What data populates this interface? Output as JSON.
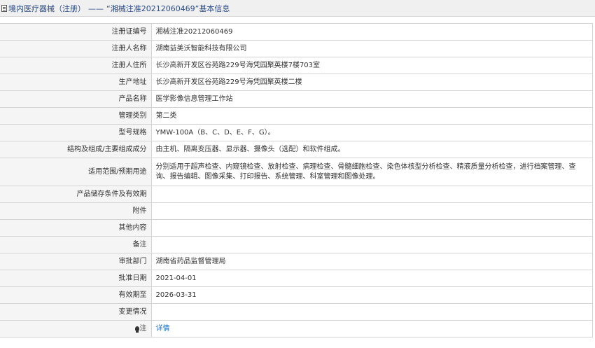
{
  "header": {
    "prefix": "境内医疗器械（注册）",
    "separator": "——",
    "subtitle": "“湘械注准20212060469”基本信息",
    "icon": "document-icon"
  },
  "rows": [
    {
      "label": "注册证编号",
      "value": "湘械注准20212060469"
    },
    {
      "label": "注册人名称",
      "value": "湖南益美沃智能科技有限公司"
    },
    {
      "label": "注册人住所",
      "value": "长沙高新开发区谷苑路229号海凭园聚英楼7楼703室"
    },
    {
      "label": "生产地址",
      "value": "长沙高新开发区谷苑路229号海凭园聚英楼二楼"
    },
    {
      "label": "产品名称",
      "value": "医学影像信息管理工作站"
    },
    {
      "label": "管理类别",
      "value": "第二类"
    },
    {
      "label": "型号规格",
      "value": "YMW-100A（B、C、D、E、F、G）。"
    },
    {
      "label": "结构及组成/主要组成成分",
      "value": "由主机、隔离变压器、显示器、摄像头（选配）和软件组成。"
    },
    {
      "label": "适用范围/预期用途",
      "value": "分别适用于超声检查、内窥镜检查、放射检查、病理检查、骨髓细胞检查、染色体核型分析检查、精液质量分析检查，进行档案管理、查询、报告编辑、图像采集、打印报告、系统管理、科室管理和图像处理。"
    },
    {
      "label": "产品储存条件及有效期",
      "value": ""
    },
    {
      "label": "附件",
      "value": ""
    },
    {
      "label": "其他内容",
      "value": ""
    },
    {
      "label": "备注",
      "value": ""
    },
    {
      "label": "审批部门",
      "value": "湖南省药品监督管理局"
    },
    {
      "label": "批准日期",
      "value": "2021-04-01"
    },
    {
      "label": "有效期至",
      "value": "2026-03-31"
    },
    {
      "label": "变更情况",
      "value": ""
    }
  ],
  "note": {
    "label": "注",
    "link": "详情",
    "icon": "lightbulb-icon"
  },
  "colors": {
    "header_bg": "#f0f0f0",
    "label_bg": "#f5f5f5",
    "link": "#1d6fc2",
    "border": "#d4d4d4"
  }
}
